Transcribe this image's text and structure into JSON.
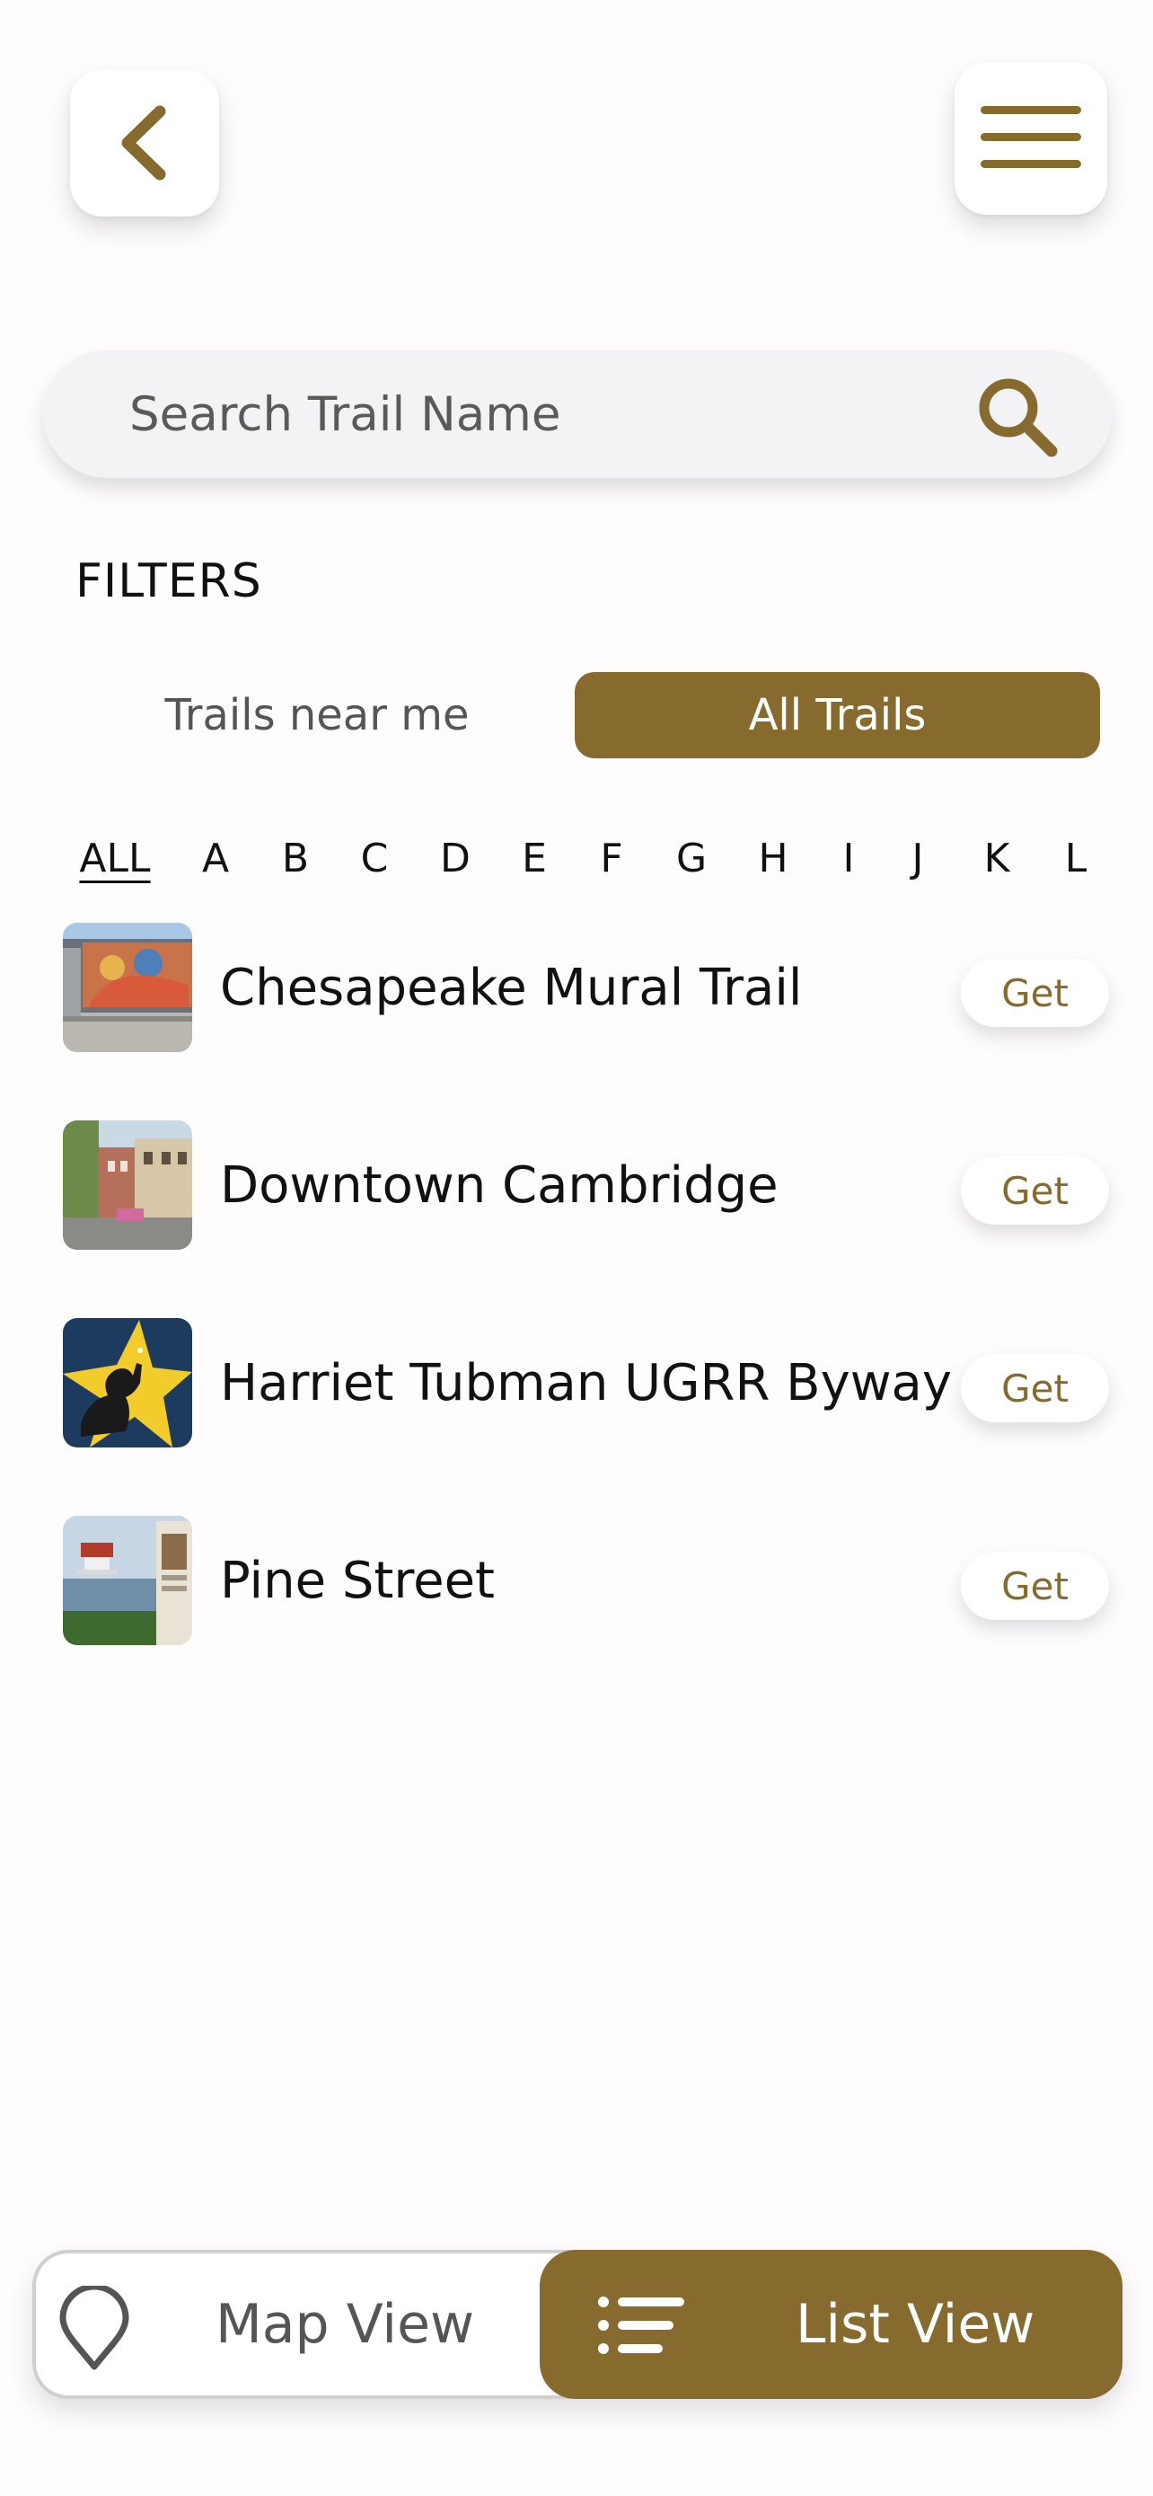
{
  "header": {
    "back_icon": "chevron-left-icon",
    "menu_icon": "hamburger-menu-icon"
  },
  "search": {
    "placeholder": "Search Trail Name",
    "icon": "search-icon"
  },
  "filters": {
    "label": "FILTERS",
    "options": [
      "Trails near me",
      "All Trails"
    ],
    "selected": "All Trails"
  },
  "alphabet": {
    "letters": [
      "ALL",
      "A",
      "B",
      "C",
      "D",
      "E",
      "F",
      "G",
      "H",
      "I",
      "J",
      "K",
      "L"
    ],
    "selected": "ALL"
  },
  "trails": [
    {
      "name": "Chesapeake Mural Trail",
      "action": "Get"
    },
    {
      "name": "Downtown Cambridge",
      "action": "Get"
    },
    {
      "name": "Harriet Tubman UGRR Byway",
      "action": "Get"
    },
    {
      "name": "Pine Street",
      "action": "Get"
    }
  ],
  "view_toggle": {
    "map_label": "Map View",
    "map_icon": "map-pin-icon",
    "list_label": "List View",
    "list_icon": "list-icon",
    "selected": "List View"
  },
  "colors": {
    "accent": "#876a2d",
    "background": "#fefcfd",
    "search_bg": "#f3f2f4"
  }
}
